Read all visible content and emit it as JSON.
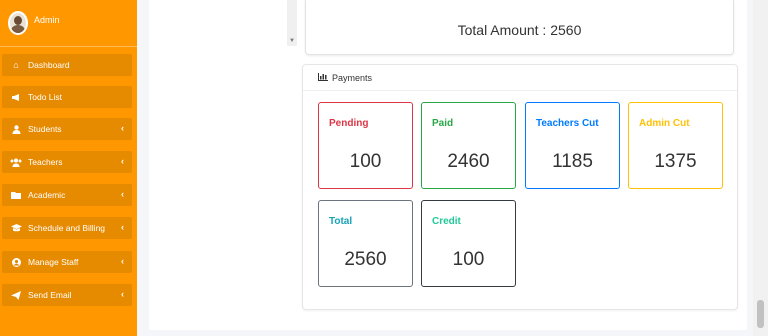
{
  "sidebar": {
    "user_name": "Admin",
    "items": [
      {
        "label": "Dashboard",
        "icon": "home-icon",
        "has_chevron": false
      },
      {
        "label": "Todo List",
        "icon": "megaphone-icon",
        "has_chevron": false
      },
      {
        "label": "Students",
        "icon": "user-icon",
        "has_chevron": true
      },
      {
        "label": "Teachers",
        "icon": "users-icon",
        "has_chevron": true
      },
      {
        "label": "Academic",
        "icon": "folder-icon",
        "has_chevron": true
      },
      {
        "label": "Schedule and Billing",
        "icon": "graduation-cap-icon",
        "has_chevron": true
      },
      {
        "label": "Manage Staff",
        "icon": "user-circle-icon",
        "has_chevron": true
      },
      {
        "label": "Send Email",
        "icon": "paper-plane-icon",
        "has_chevron": true
      }
    ]
  },
  "total_card": {
    "text": "Total Amount : 2560"
  },
  "payments": {
    "title": "Payments",
    "icon": "bar-chart-icon",
    "stats": [
      {
        "label": "Pending",
        "value": "100",
        "color": "#dc3545"
      },
      {
        "label": "Paid",
        "value": "2460",
        "color": "#28a745"
      },
      {
        "label": "Teachers Cut",
        "value": "1185",
        "color": "#007bff"
      },
      {
        "label": "Admin Cut",
        "value": "1375",
        "color": "#ffc107"
      },
      {
        "label": "Total",
        "value": "2560",
        "color": "#17a2b8"
      },
      {
        "label": "Credit",
        "value": "100",
        "color": "#20c997"
      }
    ]
  },
  "colors": {
    "sidebar_bg": "#ff9800",
    "sidebar_item_bg": "#e68a00"
  }
}
